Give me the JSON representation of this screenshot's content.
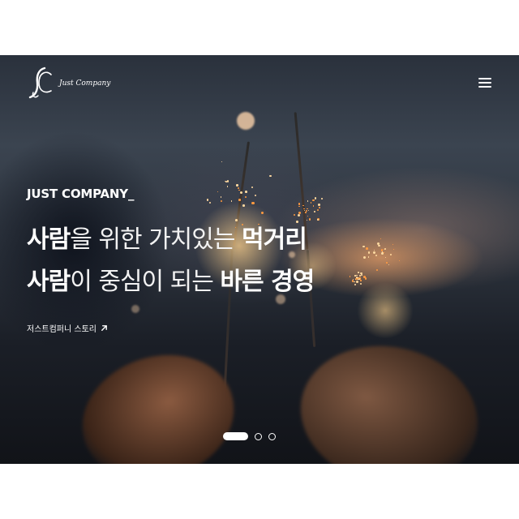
{
  "brand": {
    "name": "Just Company",
    "logo_icon": "jc-monogram-icon"
  },
  "header": {
    "menu_icon": "hamburger-menu-icon"
  },
  "hero": {
    "eyebrow": "JUST COMPANY_",
    "line1": {
      "strong_a": "사람",
      "regular": "을 위한 가치있는 ",
      "strong_b": "먹거리"
    },
    "line2": {
      "strong_a": "사람",
      "regular": "이 중심이 되는 ",
      "strong_b": "바른 경영"
    },
    "link_label": "저스트컴퍼니 스토리",
    "link_icon": "arrow-up-right-icon"
  },
  "pagination": {
    "total": 3,
    "active_index": 1
  },
  "colors": {
    "text": "#ffffff",
    "page_bg": "#ffffff"
  }
}
